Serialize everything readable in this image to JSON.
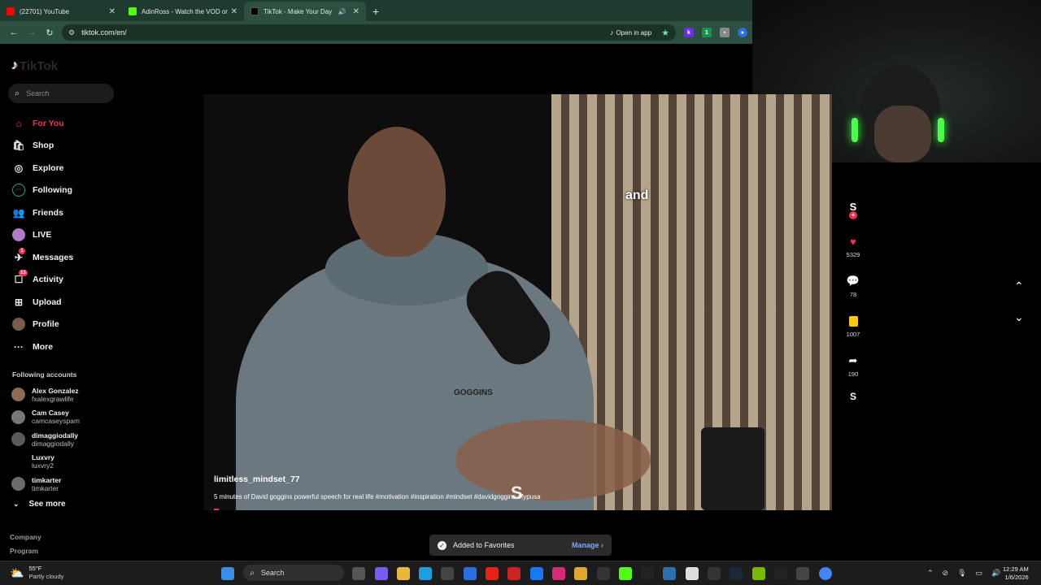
{
  "browser": {
    "tabs": [
      {
        "title": "(22701) YouTube",
        "color": "#ff0000",
        "active": false
      },
      {
        "title": "AdinRoss - Watch the VOD on",
        "color": "#53fc18",
        "active": false
      },
      {
        "title": "TikTok - Make Your Day",
        "color": "#000000",
        "active": true
      }
    ],
    "new_tab": "+",
    "url": "tiktok.com/en/",
    "open_in_app": "Open in app"
  },
  "sidebar": {
    "logo": "TikTok",
    "search_placeholder": "Search",
    "nav": [
      {
        "label": "For You",
        "icon": "home-icon",
        "glyph": "⌂"
      },
      {
        "label": "Shop",
        "icon": "shop-icon",
        "glyph": "🛍"
      },
      {
        "label": "Explore",
        "icon": "compass-icon",
        "glyph": "◎"
      },
      {
        "label": "Following",
        "icon": "following-icon",
        "glyph": ""
      },
      {
        "label": "Friends",
        "icon": "friends-icon",
        "glyph": "👥"
      },
      {
        "label": "LIVE",
        "icon": "live-icon",
        "glyph": ""
      },
      {
        "label": "Messages",
        "icon": "messages-icon",
        "glyph": "✈",
        "badge": "1"
      },
      {
        "label": "Activity",
        "icon": "activity-icon",
        "glyph": "☐",
        "badge": "13"
      },
      {
        "label": "Upload",
        "icon": "upload-icon",
        "glyph": "⊞"
      },
      {
        "label": "Profile",
        "icon": "profile-icon",
        "glyph": ""
      },
      {
        "label": "More",
        "icon": "more-icon",
        "glyph": "···"
      }
    ],
    "following_title": "Following accounts",
    "following": [
      {
        "name": "Alex Gonzalez",
        "user": "fxalexgrawlife"
      },
      {
        "name": "Cam Casey",
        "user": "camcaseyspam"
      },
      {
        "name": "dimaggiodally",
        "user": "dimaggiodally"
      },
      {
        "name": "Luxvry",
        "user": "luxvry2"
      },
      {
        "name": "timkarter",
        "user": "timkarter"
      }
    ],
    "see_more": "See more",
    "footer": [
      "Company",
      "Program"
    ]
  },
  "video": {
    "caption": "and",
    "username": "limitless_mindset_77",
    "description": "5 minutes of David goggins powerful speech for real life #motivation #inspiration #mindset #davidgoggins #fypusa",
    "hoodie_text": "GOGGINS",
    "watermark": "S"
  },
  "actions": {
    "likes": "5329",
    "comments": "78",
    "favorites": "1007",
    "shares": "190"
  },
  "toast": {
    "message": "Added to Favorites",
    "action": "Manage"
  },
  "taskbar": {
    "temp": "55°F",
    "weather": "Partly cloudy",
    "search": "Search",
    "time": "12:29 AM",
    "date": "1/6/2026"
  }
}
